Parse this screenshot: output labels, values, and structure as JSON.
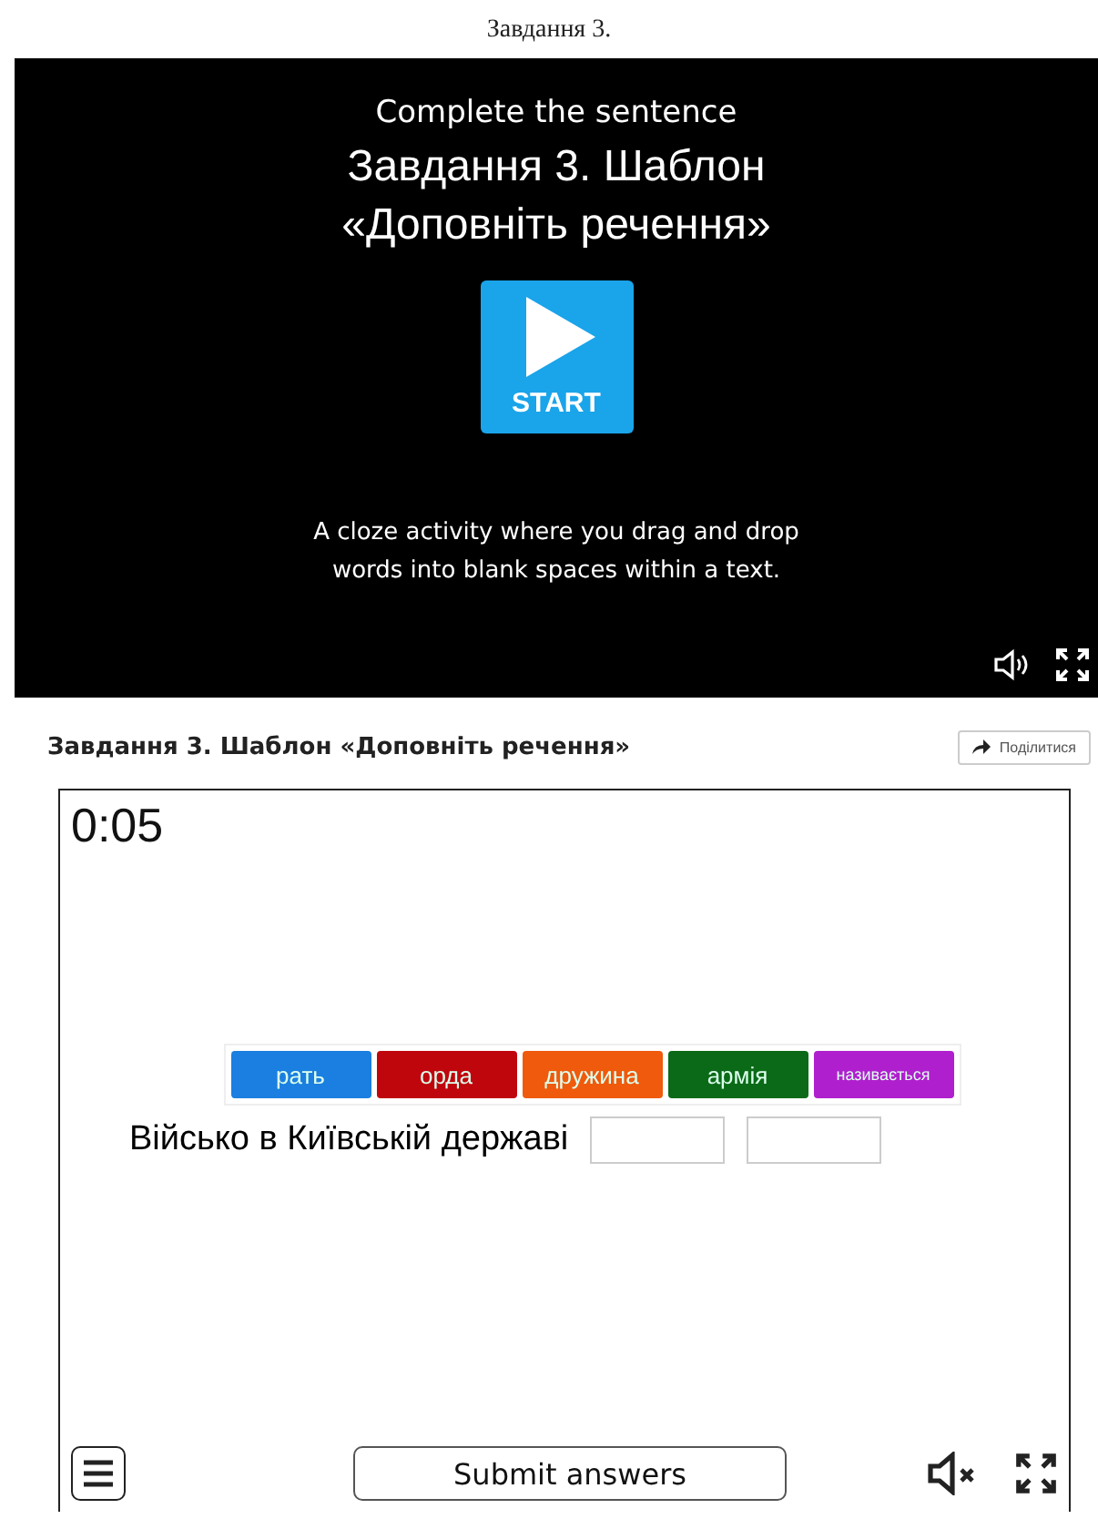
{
  "page_title": "Завдання 3.",
  "video": {
    "subtitle": "Complete the sentence",
    "title_lines": [
      "Завдання 3. Шаблон",
      "«Доповніть речення»"
    ],
    "start_label": "START",
    "description_lines": [
      "A cloze activity where you drag and drop",
      "words into blank spaces within a text."
    ]
  },
  "header": {
    "title": "Завдання 3. Шаблон «Доповніть речення»",
    "share_label": "Поділитися"
  },
  "activity": {
    "timer": "0:05",
    "words": [
      {
        "text": "рать",
        "color": "#1a7fe0"
      },
      {
        "text": "орда",
        "color": "#c0060d"
      },
      {
        "text": "дружина",
        "color": "#ef5a0c"
      },
      {
        "text": "армія",
        "color": "#0b6a17"
      },
      {
        "text": "називається",
        "color": "#b01fce"
      }
    ],
    "sentence": "Військо в Київській державі",
    "submit_label": "Submit answers"
  }
}
